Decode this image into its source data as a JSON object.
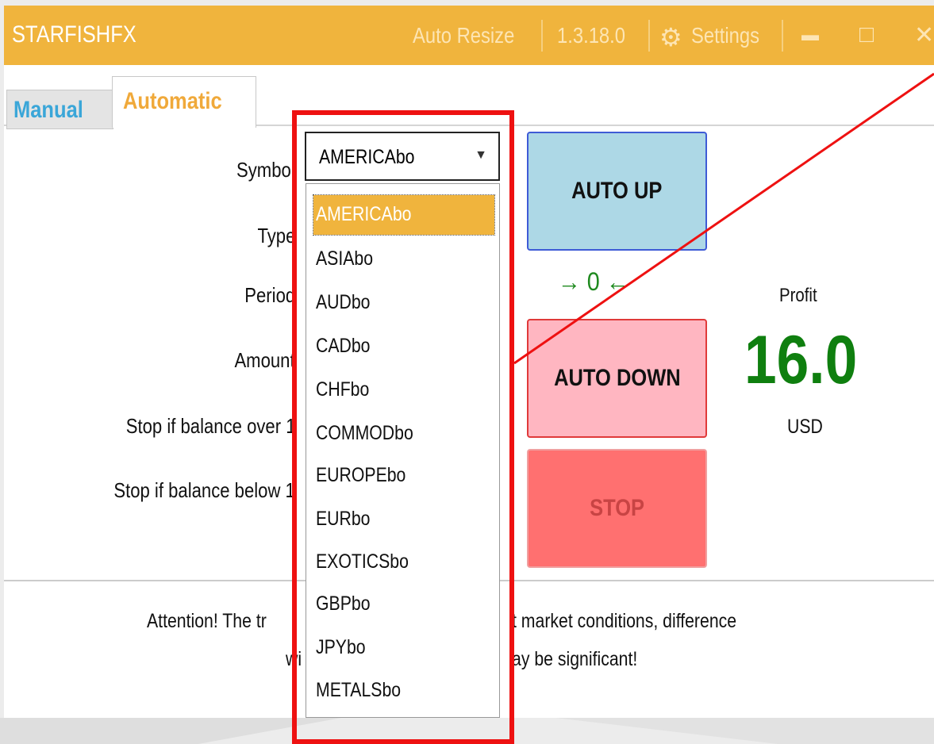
{
  "window": {
    "title": "STARFISHFX",
    "auto_resize": "Auto Resize",
    "version": "1.3.18.0",
    "settings": "Settings",
    "minimize_glyph": "▬",
    "maximize_glyph": "□",
    "close_glyph": "✕"
  },
  "tabs": {
    "manual": "Manual",
    "automatic": "Automatic"
  },
  "form": {
    "symbol_label": "Symbol",
    "type_label": "Type",
    "period_label": "Period",
    "amount_label": "Amount",
    "stop_over_label": "Stop if balance over 1",
    "stop_below_label": "Stop if balance below 1",
    "symbol_value": "AMERICAbo"
  },
  "dropdown": {
    "options": [
      "AMERICAbo",
      "ASIAbo",
      "AUDbo",
      "CADbo",
      "CHFbo",
      "COMMODbo",
      "EUROPEbo",
      "EURbo",
      "EXOTICSbo",
      "GBPbo",
      "JPYbo",
      "METALSbo"
    ],
    "selected_index": 0
  },
  "buttons": {
    "auto_up": "AUTO UP",
    "auto_down": "AUTO DOWN",
    "stop": "STOP"
  },
  "counter": {
    "value": "→ 0 ←"
  },
  "profit": {
    "label": "Profit",
    "value": "16.0",
    "currency": "USD"
  },
  "attention": {
    "line1_a": "Attention! The tr",
    "line1_b": "t market conditions, difference",
    "line2_a": "wi",
    "line2_b": "ay be significant!"
  },
  "colors": {
    "accent": "#f0b43d",
    "up": "#add8e6",
    "down": "#ffb6c1",
    "stop": "#ff7070",
    "profit": "#0f7f0f",
    "highlight": "#ee1111"
  }
}
